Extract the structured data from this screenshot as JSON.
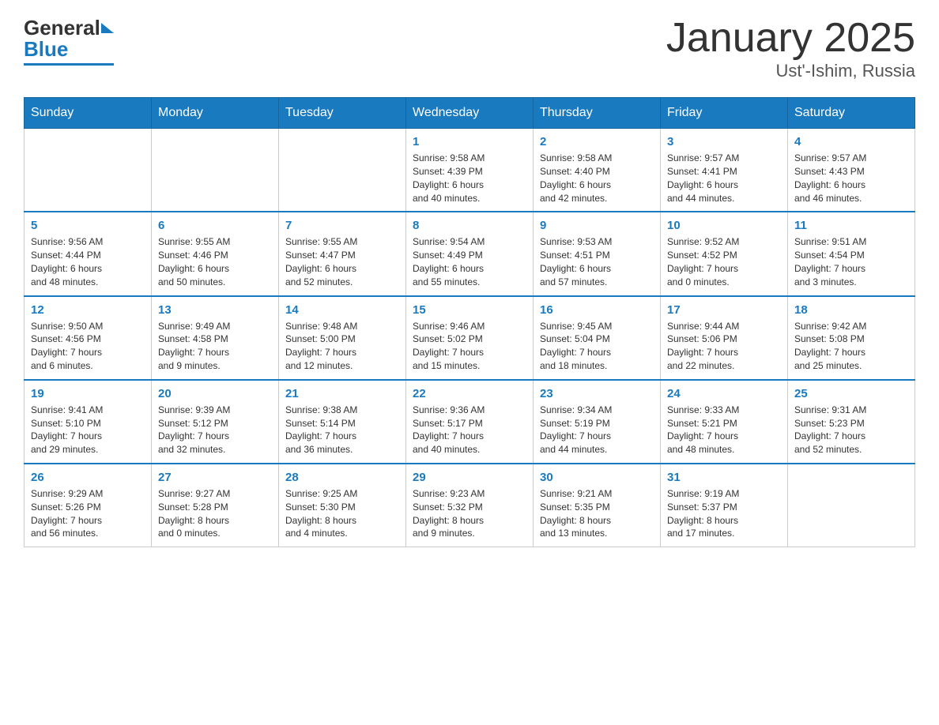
{
  "header": {
    "logo_general": "General",
    "logo_blue": "Blue",
    "title": "January 2025",
    "subtitle": "Ust'-Ishim, Russia"
  },
  "days_of_week": [
    "Sunday",
    "Monday",
    "Tuesday",
    "Wednesday",
    "Thursday",
    "Friday",
    "Saturday"
  ],
  "weeks": [
    [
      {
        "day": "",
        "info": ""
      },
      {
        "day": "",
        "info": ""
      },
      {
        "day": "",
        "info": ""
      },
      {
        "day": "1",
        "info": "Sunrise: 9:58 AM\nSunset: 4:39 PM\nDaylight: 6 hours\nand 40 minutes."
      },
      {
        "day": "2",
        "info": "Sunrise: 9:58 AM\nSunset: 4:40 PM\nDaylight: 6 hours\nand 42 minutes."
      },
      {
        "day": "3",
        "info": "Sunrise: 9:57 AM\nSunset: 4:41 PM\nDaylight: 6 hours\nand 44 minutes."
      },
      {
        "day": "4",
        "info": "Sunrise: 9:57 AM\nSunset: 4:43 PM\nDaylight: 6 hours\nand 46 minutes."
      }
    ],
    [
      {
        "day": "5",
        "info": "Sunrise: 9:56 AM\nSunset: 4:44 PM\nDaylight: 6 hours\nand 48 minutes."
      },
      {
        "day": "6",
        "info": "Sunrise: 9:55 AM\nSunset: 4:46 PM\nDaylight: 6 hours\nand 50 minutes."
      },
      {
        "day": "7",
        "info": "Sunrise: 9:55 AM\nSunset: 4:47 PM\nDaylight: 6 hours\nand 52 minutes."
      },
      {
        "day": "8",
        "info": "Sunrise: 9:54 AM\nSunset: 4:49 PM\nDaylight: 6 hours\nand 55 minutes."
      },
      {
        "day": "9",
        "info": "Sunrise: 9:53 AM\nSunset: 4:51 PM\nDaylight: 6 hours\nand 57 minutes."
      },
      {
        "day": "10",
        "info": "Sunrise: 9:52 AM\nSunset: 4:52 PM\nDaylight: 7 hours\nand 0 minutes."
      },
      {
        "day": "11",
        "info": "Sunrise: 9:51 AM\nSunset: 4:54 PM\nDaylight: 7 hours\nand 3 minutes."
      }
    ],
    [
      {
        "day": "12",
        "info": "Sunrise: 9:50 AM\nSunset: 4:56 PM\nDaylight: 7 hours\nand 6 minutes."
      },
      {
        "day": "13",
        "info": "Sunrise: 9:49 AM\nSunset: 4:58 PM\nDaylight: 7 hours\nand 9 minutes."
      },
      {
        "day": "14",
        "info": "Sunrise: 9:48 AM\nSunset: 5:00 PM\nDaylight: 7 hours\nand 12 minutes."
      },
      {
        "day": "15",
        "info": "Sunrise: 9:46 AM\nSunset: 5:02 PM\nDaylight: 7 hours\nand 15 minutes."
      },
      {
        "day": "16",
        "info": "Sunrise: 9:45 AM\nSunset: 5:04 PM\nDaylight: 7 hours\nand 18 minutes."
      },
      {
        "day": "17",
        "info": "Sunrise: 9:44 AM\nSunset: 5:06 PM\nDaylight: 7 hours\nand 22 minutes."
      },
      {
        "day": "18",
        "info": "Sunrise: 9:42 AM\nSunset: 5:08 PM\nDaylight: 7 hours\nand 25 minutes."
      }
    ],
    [
      {
        "day": "19",
        "info": "Sunrise: 9:41 AM\nSunset: 5:10 PM\nDaylight: 7 hours\nand 29 minutes."
      },
      {
        "day": "20",
        "info": "Sunrise: 9:39 AM\nSunset: 5:12 PM\nDaylight: 7 hours\nand 32 minutes."
      },
      {
        "day": "21",
        "info": "Sunrise: 9:38 AM\nSunset: 5:14 PM\nDaylight: 7 hours\nand 36 minutes."
      },
      {
        "day": "22",
        "info": "Sunrise: 9:36 AM\nSunset: 5:17 PM\nDaylight: 7 hours\nand 40 minutes."
      },
      {
        "day": "23",
        "info": "Sunrise: 9:34 AM\nSunset: 5:19 PM\nDaylight: 7 hours\nand 44 minutes."
      },
      {
        "day": "24",
        "info": "Sunrise: 9:33 AM\nSunset: 5:21 PM\nDaylight: 7 hours\nand 48 minutes."
      },
      {
        "day": "25",
        "info": "Sunrise: 9:31 AM\nSunset: 5:23 PM\nDaylight: 7 hours\nand 52 minutes."
      }
    ],
    [
      {
        "day": "26",
        "info": "Sunrise: 9:29 AM\nSunset: 5:26 PM\nDaylight: 7 hours\nand 56 minutes."
      },
      {
        "day": "27",
        "info": "Sunrise: 9:27 AM\nSunset: 5:28 PM\nDaylight: 8 hours\nand 0 minutes."
      },
      {
        "day": "28",
        "info": "Sunrise: 9:25 AM\nSunset: 5:30 PM\nDaylight: 8 hours\nand 4 minutes."
      },
      {
        "day": "29",
        "info": "Sunrise: 9:23 AM\nSunset: 5:32 PM\nDaylight: 8 hours\nand 9 minutes."
      },
      {
        "day": "30",
        "info": "Sunrise: 9:21 AM\nSunset: 5:35 PM\nDaylight: 8 hours\nand 13 minutes."
      },
      {
        "day": "31",
        "info": "Sunrise: 9:19 AM\nSunset: 5:37 PM\nDaylight: 8 hours\nand 17 minutes."
      },
      {
        "day": "",
        "info": ""
      }
    ]
  ]
}
